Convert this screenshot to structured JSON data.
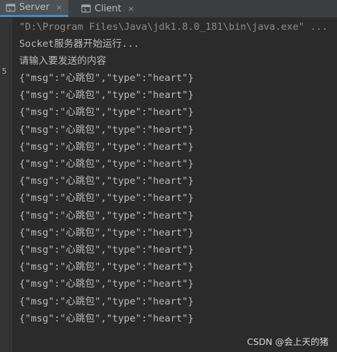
{
  "tabs": [
    {
      "label": "Server",
      "icon": "server-run-icon",
      "active": true,
      "close": "×"
    },
    {
      "label": "Client",
      "icon": "client-run-icon",
      "active": false,
      "close": "×"
    }
  ],
  "gutter": {
    "mark": "5"
  },
  "console": {
    "command": "\"D:\\Program Files\\Java\\jdk1.8.0_181\\bin\\java.exe\" ...",
    "startup": "Socket服务器开始运行...",
    "prompt": "请输入要发送的内容",
    "messages": [
      "{\"msg\":\"心跳包\",\"type\":\"heart\"}",
      "{\"msg\":\"心跳包\",\"type\":\"heart\"}",
      "{\"msg\":\"心跳包\",\"type\":\"heart\"}",
      "{\"msg\":\"心跳包\",\"type\":\"heart\"}",
      "{\"msg\":\"心跳包\",\"type\":\"heart\"}",
      "{\"msg\":\"心跳包\",\"type\":\"heart\"}",
      "{\"msg\":\"心跳包\",\"type\":\"heart\"}",
      "{\"msg\":\"心跳包\",\"type\":\"heart\"}",
      "{\"msg\":\"心跳包\",\"type\":\"heart\"}",
      "{\"msg\":\"心跳包\",\"type\":\"heart\"}",
      "{\"msg\":\"心跳包\",\"type\":\"heart\"}",
      "{\"msg\":\"心跳包\",\"type\":\"heart\"}",
      "{\"msg\":\"心跳包\",\"type\":\"heart\"}",
      "{\"msg\":\"心跳包\",\"type\":\"heart\"}",
      "{\"msg\":\"心跳包\",\"type\":\"heart\"}"
    ]
  },
  "watermark": "CSDN @会上天的猪",
  "colors": {
    "background": "#2b2b2b",
    "tabbar": "#3c3f41",
    "active_tab": "#4e5254",
    "active_underline": "#4a88c7",
    "text": "#bbbbbb",
    "command_text": "#8c8c8c"
  }
}
